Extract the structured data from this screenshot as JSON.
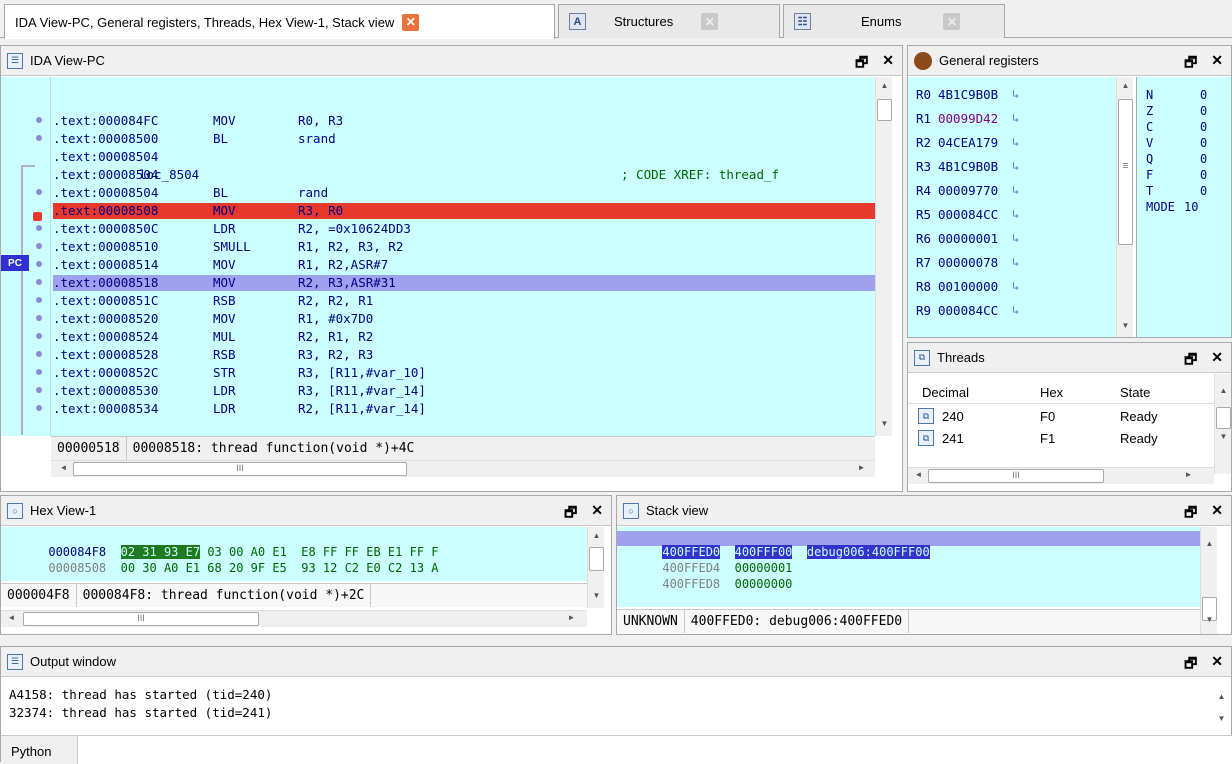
{
  "tabs": [
    {
      "label": "IDA View-PC, General registers, Threads, Hex View-1, Stack view",
      "icon": "close-icon-orange",
      "active": true
    },
    {
      "label": "Structures",
      "icon": "structures-icon"
    },
    {
      "label": "Enums",
      "icon": "enums-icon"
    }
  ],
  "ida_view": {
    "title": "IDA View-PC",
    "lines": [
      {
        "addr": ".text:000084FC",
        "mn": "MOV",
        "op": "R0, R3",
        "cm": ""
      },
      {
        "addr": ".text:00008500",
        "mn": "BL",
        "op": "srand",
        "cm": ""
      },
      {
        "addr": ".text:00008504",
        "mn": "",
        "op": "",
        "cm": ""
      },
      {
        "addr": ".text:00008504",
        "mn": "loc_8504",
        "op": "",
        "cm": "; CODE XREF: thread_f"
      },
      {
        "addr": ".text:00008504",
        "mn": "BL",
        "op": "rand",
        "cm": ""
      },
      {
        "addr": ".text:00008508",
        "mn": "MOV",
        "op": "R3, R0",
        "cm": ""
      },
      {
        "addr": ".text:0000850C",
        "mn": "LDR",
        "op": "R2, =0x10624DD3",
        "cm": ""
      },
      {
        "addr": ".text:00008510",
        "mn": "SMULL",
        "op": "R1, R2, R3, R2",
        "cm": ""
      },
      {
        "addr": ".text:00008514",
        "mn": "MOV",
        "op": "R1, R2,ASR#7",
        "cm": ""
      },
      {
        "addr": ".text:00008518",
        "mn": "MOV",
        "op": "R2, R3,ASR#31",
        "cm": ""
      },
      {
        "addr": ".text:0000851C",
        "mn": "RSB",
        "op": "R2, R2, R1",
        "cm": ""
      },
      {
        "addr": ".text:00008520",
        "mn": "MOV",
        "op": "R1, #0x7D0",
        "cm": ""
      },
      {
        "addr": ".text:00008524",
        "mn": "MUL",
        "op": "R2, R1, R2",
        "cm": ""
      },
      {
        "addr": ".text:00008528",
        "mn": "RSB",
        "op": "R3, R2, R3",
        "cm": ""
      },
      {
        "addr": ".text:0000852C",
        "mn": "STR",
        "op": "R3, [R11,#var_10]",
        "cm": ""
      },
      {
        "addr": ".text:00008530",
        "mn": "LDR",
        "op": "R3, [R11,#var_14]",
        "cm": ""
      },
      {
        "addr": ".text:00008534",
        "mn": "LDR",
        "op": "R2, [R11,#var_14]",
        "cm": ""
      }
    ],
    "pc_label": "PC",
    "status_offset": "00000518",
    "status_text": "00008518: thread function(void *)+4C",
    "hscroll_grip": "III"
  },
  "registers": {
    "title": "General registers",
    "regs": [
      {
        "name": "R0",
        "value": "4B1C9B0B"
      },
      {
        "name": "R1",
        "value": "00099D42"
      },
      {
        "name": "R2",
        "value": "04CEA179"
      },
      {
        "name": "R3",
        "value": "4B1C9B0B"
      },
      {
        "name": "R4",
        "value": "00009770"
      },
      {
        "name": "R5",
        "value": "000084CC"
      },
      {
        "name": "R6",
        "value": "00000001"
      },
      {
        "name": "R7",
        "value": "00000078"
      },
      {
        "name": "R8",
        "value": "00100000"
      },
      {
        "name": "R9",
        "value": "000084CC"
      }
    ],
    "flags": [
      {
        "name": "N",
        "value": "0"
      },
      {
        "name": "Z",
        "value": "0"
      },
      {
        "name": "C",
        "value": "0"
      },
      {
        "name": "V",
        "value": "0"
      },
      {
        "name": "Q",
        "value": "0"
      },
      {
        "name": "F",
        "value": "0"
      },
      {
        "name": "T",
        "value": "0"
      },
      {
        "name": "MODE",
        "value": "10"
      }
    ],
    "arrow_glyph": "↳",
    "grip": "≡"
  },
  "threads": {
    "title": "Threads",
    "columns": [
      "Decimal",
      "Hex",
      "State"
    ],
    "rows": [
      {
        "decimal": "240",
        "hex": "F0",
        "state": "Ready"
      },
      {
        "decimal": "241",
        "hex": "F1",
        "state": "Ready"
      }
    ],
    "hscroll_grip": "III"
  },
  "hex_view": {
    "title": "Hex View-1",
    "lines": [
      {
        "addr": "000084F8",
        "sel": "02 31 93 E7",
        "rest": " 03 00 A0 E1  E8 FF FF EB E1 FF F"
      },
      {
        "addr": "00008508",
        "sel": "",
        "rest": "  00 30 A0 E1 68 20 9F E5  93 12 C2 E0 C2 13 A"
      }
    ],
    "status_offset": "000004F8",
    "status_text": "000084F8: thread function(void *)+2C",
    "hscroll_grip": "III"
  },
  "stack_view": {
    "title": "Stack view",
    "lines": [
      {
        "addr": "400FFED0",
        "value": "400FFF00",
        "comment": "debug006:400FFF00"
      },
      {
        "addr": "400FFED4",
        "value": "00000001",
        "comment": ""
      },
      {
        "addr": "400FFED8",
        "value": "00000000",
        "comment": ""
      }
    ],
    "status_type": "UNKNOWN",
    "status_text": "400FFED0: debug006:400FFED0"
  },
  "output": {
    "title": "Output window",
    "lines": [
      "A4158: thread has started (tid=240)",
      "32374: thread has started (tid=241)"
    ]
  },
  "python_label": "Python",
  "panel_ctl": {
    "float": "🗗",
    "close": "✕"
  },
  "scroll_glyphs": {
    "up": "▲",
    "down": "▼",
    "left": "◄",
    "right": "►"
  },
  "colors": {
    "code_bg": "#ccffff",
    "breakpoint_line": "#e8382e",
    "pc_line": "#a0a0f0",
    "hex_selection": "#1f7a1f",
    "stack_selection": "#3333cc"
  }
}
